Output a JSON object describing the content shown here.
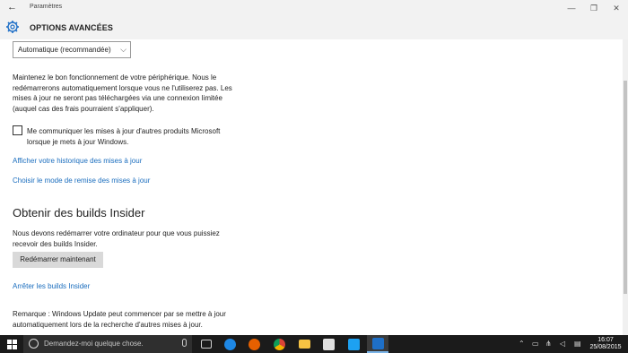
{
  "window": {
    "app_title": "Paramètres",
    "back_glyph": "←",
    "minimize_glyph": "—",
    "maximize_glyph": "❐",
    "close_glyph": "✕"
  },
  "header": {
    "title": "OPTIONS AVANCÉES",
    "icon": "gear-icon"
  },
  "update_mode": {
    "selected": "Automatique (recommandée)",
    "chevron": "⌵",
    "description": "Maintenez le bon fonctionnement de votre périphérique. Nous le redémarrerons automatiquement lorsque vous ne l'utiliserez pas. Les mises à jour ne seront pas téléchargées via une connexion limitée (auquel cas des frais pourraient s'appliquer)."
  },
  "other_products": {
    "checked": false,
    "label": "Me communiquer les mises à jour d'autres produits Microsoft lorsque je mets à jour Windows."
  },
  "links": {
    "history": "Afficher votre historique des mises à jour",
    "delivery": "Choisir le mode de remise des mises à jour"
  },
  "insider": {
    "heading": "Obtenir des builds Insider",
    "description": "Nous devons redémarrer votre ordinateur pour que vous puissiez recevoir des builds Insider.",
    "restart_button": "Redémarrer maintenant",
    "stop_link": "Arrêter les builds Insider",
    "note": "Remarque : Windows Update peut commencer par se mettre à jour automatiquement lors de la recherche d'autres mises à jour."
  },
  "taskbar": {
    "search_placeholder": "Demandez-moi quelque chose.",
    "apps": [
      {
        "name": "task-view-icon",
        "color": "#cfcfcf"
      },
      {
        "name": "edge-icon",
        "color": "#1e88e5"
      },
      {
        "name": "firefox-icon",
        "color": "#e66000"
      },
      {
        "name": "chrome-icon",
        "color": "#4caf50"
      },
      {
        "name": "file-explorer-icon",
        "color": "#f6c343"
      },
      {
        "name": "store-icon",
        "color": "#e0e0e0"
      },
      {
        "name": "twitter-icon",
        "color": "#1da1f2"
      },
      {
        "name": "settings-icon",
        "color": "#1e6fc7"
      }
    ],
    "time": "16:07",
    "date": "25/08/2015"
  },
  "colors": {
    "link": "#1a6dbe",
    "accent": "#1e6fc7",
    "taskbar": "#1b1b1b"
  }
}
